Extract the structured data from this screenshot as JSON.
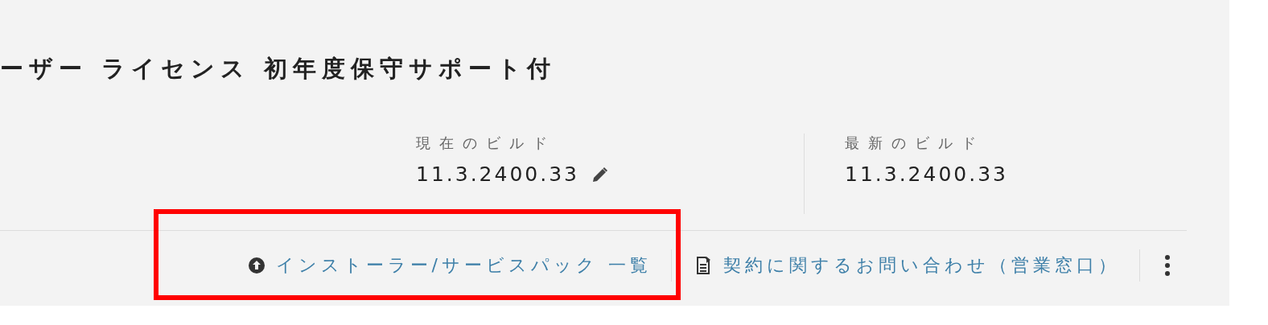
{
  "product": {
    "title": "ーザー ライセンス 初年度保守サポート付"
  },
  "builds": [
    {
      "label": "現在のビルド",
      "value": "11.3.2400.33",
      "editable": true
    },
    {
      "label": "最新のビルド",
      "value": "11.3.2400.33",
      "editable": false
    }
  ],
  "actions": [
    {
      "label": "インストーラー/サービスパック 一覧",
      "kind": "upload",
      "highlighted": true
    },
    {
      "label": "契約に関するお問い合わせ（営業窓口）",
      "kind": "document",
      "highlighted": false
    }
  ],
  "more_menu": true
}
